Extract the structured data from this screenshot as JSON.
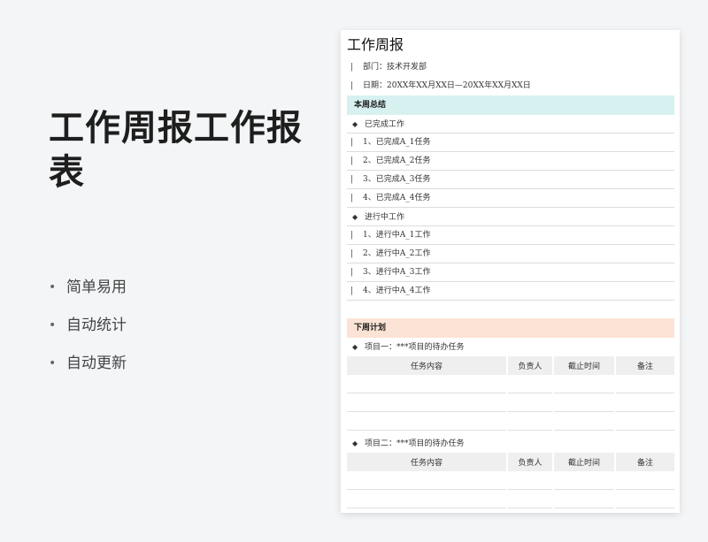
{
  "hero": {
    "title": "工作周报工作报表"
  },
  "features": [
    "简单易用",
    "自动统计",
    "自动更新"
  ],
  "doc": {
    "title": "工作周报",
    "department": "部门：技术开发部",
    "date": "日期：20XX年XX月XX日—20XX年XX月XX日",
    "summary": {
      "heading": "本周总结",
      "done_heading": "已完成工作",
      "done_items": [
        "1、已完成A_1任务",
        "2、已完成A_2任务",
        "3、已完成A_3任务",
        "4、已完成A_4任务"
      ],
      "doing_heading": "进行中工作",
      "doing_items": [
        "1、进行中A_1工作",
        "2、进行中A_2工作",
        "3、进行中A_3工作",
        "4、进行中A_4工作"
      ]
    },
    "plan": {
      "heading": "下周计划",
      "projects": [
        {
          "title": "项目一：***项目的待办任务"
        },
        {
          "title": "项目二：***项目的待办任务"
        }
      ],
      "columns": [
        "任务内容",
        "负责人",
        "截止时间",
        "备注"
      ]
    }
  },
  "colors": {
    "summary_bg": "#d7f1f1",
    "plan_bg": "#fbe4d5",
    "page_bg": "#f3f5f7"
  }
}
